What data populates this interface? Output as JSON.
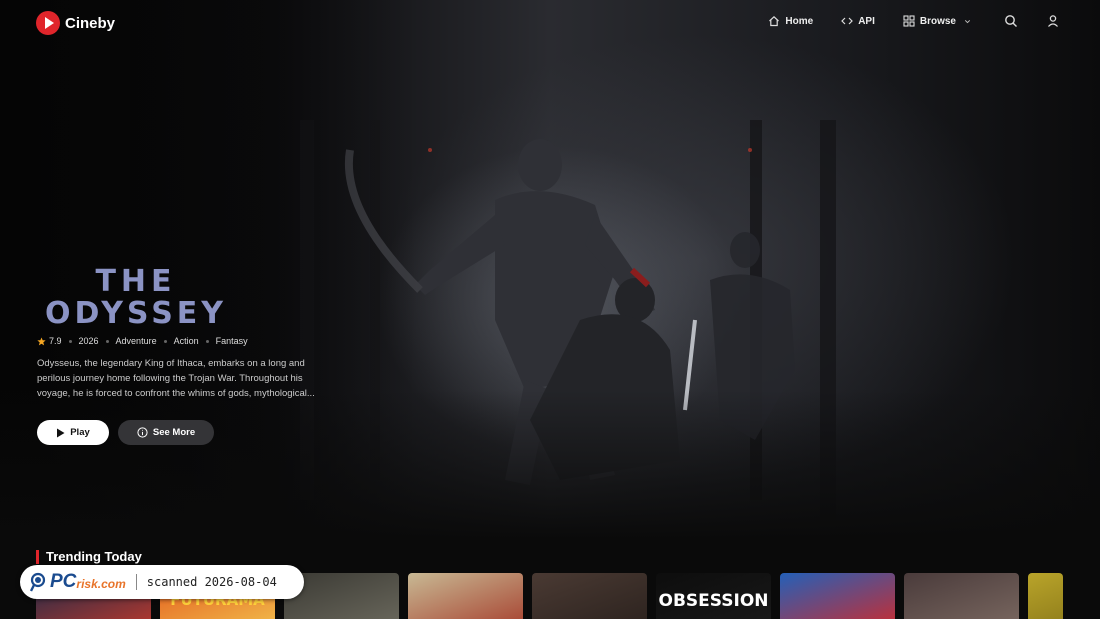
{
  "brand": {
    "name": "Cineby"
  },
  "nav": {
    "items": [
      {
        "label": "Home",
        "icon": "home-icon"
      },
      {
        "label": "API",
        "icon": "code-icon"
      },
      {
        "label": "Browse",
        "icon": "grid-icon"
      }
    ],
    "search_icon": "search-icon",
    "user_icon": "user-icon"
  },
  "hero": {
    "title_line1": "THE",
    "title_line2": "ODYSSEY",
    "rating": "7.9",
    "year": "2026",
    "genres": [
      "Adventure",
      "Action",
      "Fantasy"
    ],
    "description": "Odysseus, the legendary King of Ithaca, embarks on a long and perilous journey home following the Trojan War. Throughout his voyage, he is forced to confront the whims of gods, mythological...",
    "play_label": "Play",
    "see_more_label": "See More"
  },
  "trending": {
    "title": "Trending Today",
    "posters": [
      {
        "label": "",
        "colors": [
          "#1b2a4a",
          "#c0392b"
        ]
      },
      {
        "label": "FUTURAMA",
        "colors": [
          "#e35a1c",
          "#f2c14e"
        ]
      },
      {
        "label": "",
        "colors": [
          "#3b3a34",
          "#6d6b5f"
        ]
      },
      {
        "label": "",
        "colors": [
          "#c8b994",
          "#a53b2a"
        ]
      },
      {
        "label": "",
        "colors": [
          "#4a3a33",
          "#2a211d"
        ]
      },
      {
        "label": "OBSESSION",
        "colors": [
          "#0d0d0d",
          "#1a1a1a"
        ]
      },
      {
        "label": "",
        "colors": [
          "#2460b8",
          "#d12a2a"
        ]
      },
      {
        "label": "",
        "colors": [
          "#4a3b3b",
          "#7c6a62"
        ]
      },
      {
        "label": "",
        "colors": [
          "#b9a42a",
          "#8c7a1a"
        ]
      }
    ]
  },
  "watermark": {
    "logo_pc": "PC",
    "logo_risk": "risk.com",
    "text": "scanned 2026-08-04"
  }
}
